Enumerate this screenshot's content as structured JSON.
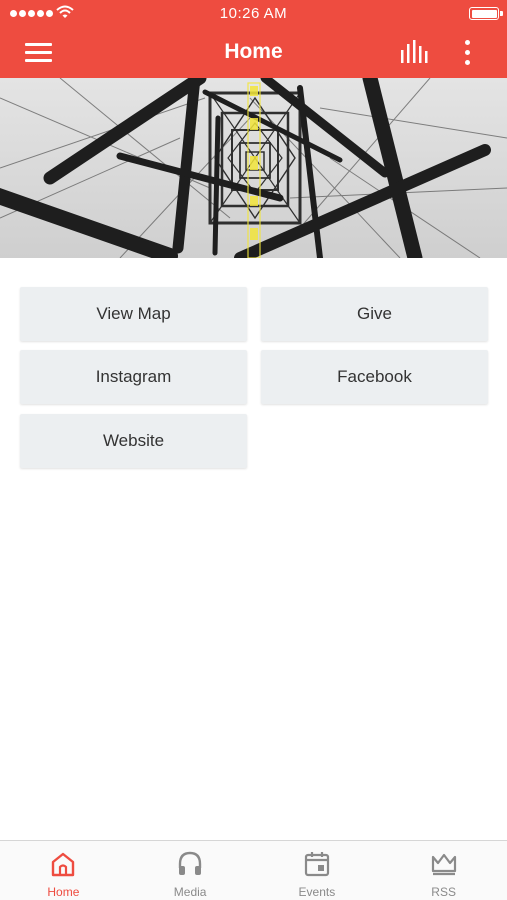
{
  "status_bar": {
    "time": "10:26 AM"
  },
  "header": {
    "title": "Home"
  },
  "hero": {
    "alt": "Steel tower structure with yellow vertical sign"
  },
  "buttons": [
    {
      "label": "View Map"
    },
    {
      "label": "Give"
    },
    {
      "label": "Instagram"
    },
    {
      "label": "Facebook"
    },
    {
      "label": "Website"
    }
  ],
  "tabs": [
    {
      "label": "Home",
      "icon": "home-icon",
      "active": true
    },
    {
      "label": "Media",
      "icon": "headphones-icon",
      "active": false
    },
    {
      "label": "Events",
      "icon": "calendar-icon",
      "active": false
    },
    {
      "label": "RSS",
      "icon": "crown-icon",
      "active": false
    }
  ],
  "colors": {
    "accent": "#ee4c40",
    "button_bg": "#eceff1",
    "inactive": "#8a8a8a"
  }
}
